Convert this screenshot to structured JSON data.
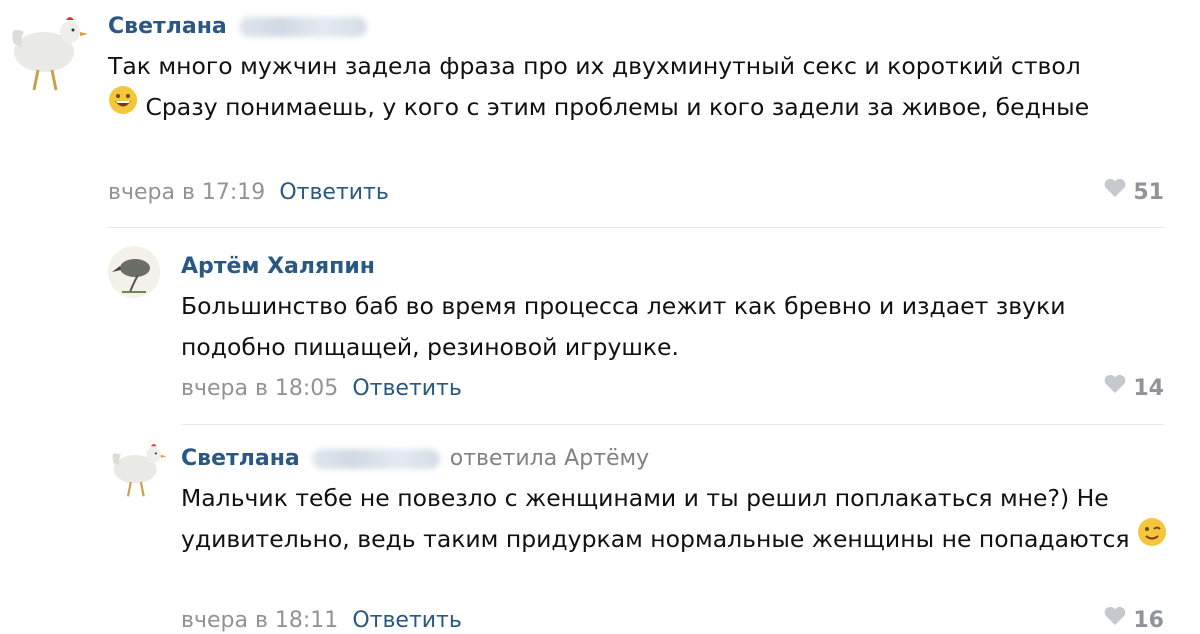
{
  "comments": [
    {
      "author": "Светлана",
      "replied_to": "",
      "text_before_emoji": "Так много мужчин задела фраза про их двухминутный секс и короткий ствол",
      "emoji": "grinning-face",
      "text_after_emoji": " Сразу понимаешь, у кого с этим проблемы и кого задели за живое, бедные",
      "time": "вчера в 17:19",
      "reply_label": "Ответить",
      "likes": "51"
    },
    {
      "author": "Артём Халяпин",
      "replied_to": "",
      "text_before_emoji": "Большинство баб во время процесса лежит как бревно и издает звуки подобно пищащей, резиновой игрушке.",
      "emoji": "",
      "text_after_emoji": "",
      "time": "вчера в 18:05",
      "reply_label": "Ответить",
      "likes": "14"
    },
    {
      "author": "Светлана",
      "replied_to": "ответила Артёму",
      "text_before_emoji": "Мальчик тебе не повезло с женщинами и ты решил поплакаться мне?) Не удивительно, ведь таким придуркам нормальные женщины не попадаются",
      "emoji": "winking-face",
      "text_after_emoji": "",
      "time": "вчера в 18:11",
      "reply_label": "Ответить",
      "likes": "16"
    }
  ],
  "colors": {
    "author": "#2a5885",
    "meta": "#939393",
    "likes": "#909399",
    "divider": "#e7e8ec"
  }
}
